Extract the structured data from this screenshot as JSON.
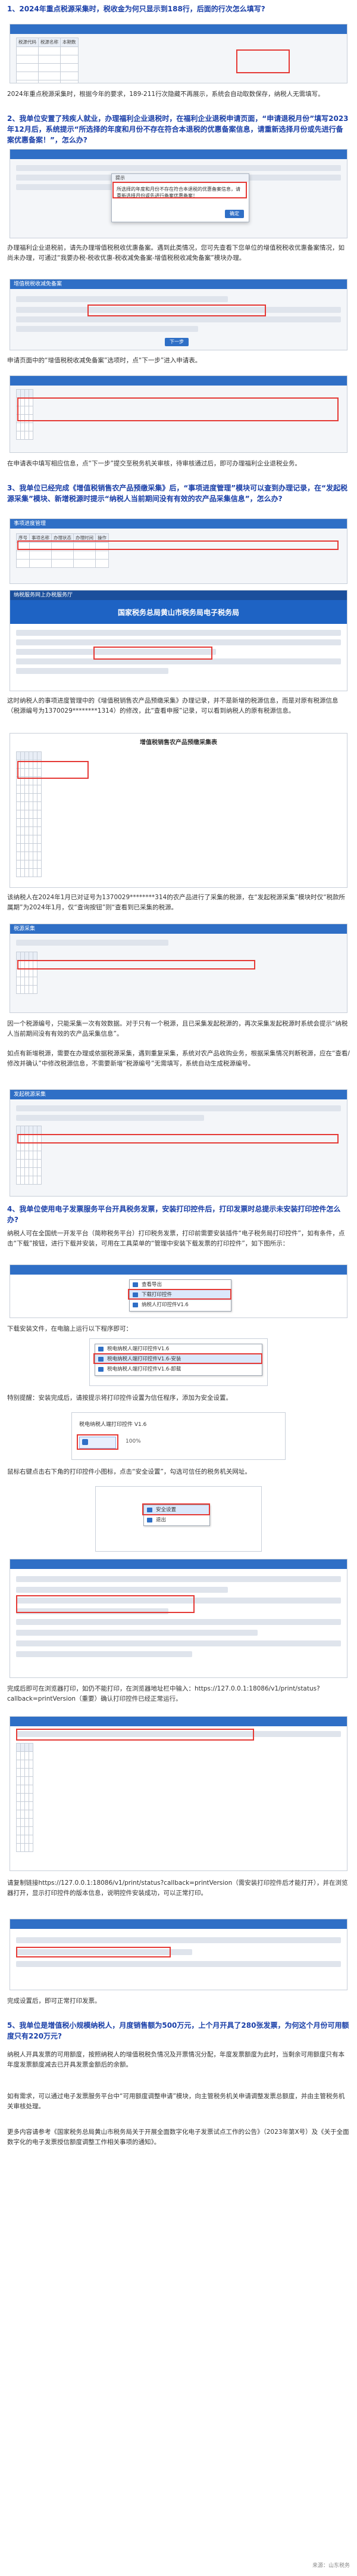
{
  "q1": {
    "title": "1、2024年重点税源采集时，税收金为何只显示到188行，后面的行次怎么填写?",
    "answer": "2024年重点税源采集时，根据今年的要求，189-211行次隐藏不再展示，系统会自动取数保存，纳税人无需填写。",
    "shot_items": [
      "税源代码",
      "税源名称",
      "本期数"
    ]
  },
  "q2": {
    "title": "2、我单位安置了残疾人就业，办理福利企业退税时，在福利企业退税申请页面，“申请退税月份”填写2023年12月后，系统提示“所选择的年度和月份不存在符合本退税的优惠备案信息，请重新选择月份或先进行备案优惠备案！”，怎么办?",
    "shot_popup_title": "提示",
    "shot_popup_text": "所选择的年度和月份不存在符合本退税的优惠备案信息，请重新选择月份或先进行备案优惠备案！",
    "shot_popup_btn": "确定",
    "answer": "办理福利企业退税前，请先办理增值税税收优惠备案。遇到此类情况，您可先查看下您单位的增值税税收优惠备案情况，如尚未办理，可通过“我要办税-税收优惠-税收减免备案-增值税税收减免备案”模块办理。",
    "shot2_bar": "增值税税收减免备案",
    "shot2_btn": "下一步",
    "answer2": "申请页面中的“增值税税收减免备案”选项时，点“下一步”进入申请表。",
    "answer3": "在申请表中填写相应信息，点“下一步”提交至税务机关审核，待审核通过后，即可办理福利企业退税业务。"
  },
  "q3": {
    "title": "3、我单位已经完成《增值税销售农产品预缴采集》后，“事项进度管理”模块可以查到办理记录，在“发起税源采集”模块、新增税源时提示“纳税人当前期间没有有效的农产品采集信息”，怎么办?",
    "shot_bar": "事项进度管理",
    "shot_cols": [
      "序号",
      "事项名称",
      "办理状态",
      "办理时间",
      "操作"
    ],
    "shot2_bar": "纳税服务网上办税服务厅",
    "shot2_subtitle": "国家税务总局黄山市税务局电子税务局",
    "answer": "这时纳税人的事项进度管理中的《增值税销售农产品预缴采集》办理记录，并不是新增的税源信息，而是对原有税源信息（税源编号为1370029********1314）的修改，此“查看申报”记录，可以看到纳税人的原有税源信息。",
    "shot3_title": "增值税销售农产品预缴采集表",
    "answer2": "该纳税人在2024年1月已对证号为1370029********314的农产品进行了采集的税源，在“发起税源采集”模块时仅“税款所属期”为2024年1月，仅“查询按钮”则“查看到已采集的税源。",
    "shot4_bar": "税源采集",
    "answer3": "因一个税源编号，只能采集一次有效数据。对于只有一个税源，且已采集发起税源的，再次采集发起税源时系统会提示“纳税人当前期间没有有效的农产品采集信息”。",
    "answer4": "如点有新增税源，需要在办理或依据税源采集，遇到重复采集，系统对农产品收购业务，根据采集情况判断税源，应在“查看/修改并确认”中修改税源信息，不需要新增“税源编号”无需填写，系统自动生成税源编号。",
    "shot5_bar": "发起税源采集"
  },
  "q4": {
    "title": "4、我单位使用电子发票服务平台开具税务发票，安装打印控件后，打印发票时总提示未安装打印控件怎么办?",
    "answer": "纳税人可在全国统一开发平台（简称税务平台）打印税务发票，打印前需要安装插件“电子税务局打印控件”，如有条件，点击“下载”按钮，进行下载并安装，可用在工具菜单的“管理中安装下载发票的打印控件”，如下图所示：",
    "menu_items": [
      "查看导出",
      "下载打印控件",
      "纳税人打印控件V1.6"
    ],
    "answer2": "下载安装文件，在电脑上运行以下程序即可：",
    "menu2_items": [
      "税电纳税人端打印控件V1.6",
      "税电纳税人端打印控件V1.6-安装",
      "税电纳税人端打印控件V1.6-卸载"
    ],
    "answer3": "特别提醒：安装完成后，请按提示将打印控件设置为信任程序，添加为安全设置。",
    "shot_control_label": "税电纳税人端打印控件 V1.6",
    "shot_zoom": "100%",
    "answer4": "鼠标右键点击右下角的打印控件小图标，点击“安全设置”，勾选可信任的税务机关网址。",
    "menu3_items": [
      "安全设置",
      "退出"
    ],
    "answer5": "完成后即可在浏览器打印，如仍不能打印，在浏览器地址栏中输入：https://127.0.0.1:18086/v1/print/status?callback=printVersion（重要）确认打印控件已经正常运行。",
    "answer6": "请复制链接https://127.0.0.1:18086/v1/print/status?callback=printVersion（需安装打印控件后才能打开），并在浏览器打开，显示打印控件的版本信息，说明控件安装成功，可以正常打印。",
    "answer7": "完成设置后，即可正常打印发票。"
  },
  "q5": {
    "title": "5、我单位是增值税小规模纳税人，月度销售额为500万元，上个月开具了280张发票，为何这个月份可用额度只有220万元?",
    "answer": "纳税人开具发票的可用额度，按照纳税人的增值税税负情况及开票情况分配，年度发票额度为此时，当剩余可用额度只有本年度发票额度减去已开具发票金额后的余额。",
    "answer2": "如有需求，可以通过电子发票服务平台中“可用额度调整申请”模块，向主管税务机关申请调整发票总额度，并由主管税务机关审核处理。",
    "answer3": "更多内容请参考《国家税务总局黄山市税务局关于开展全面数字化电子发票试点工作的公告》（2023年第X号）及《关于全面数字化的电子发票授信额度调整工作相关事项的通知》。",
    "source": "来源：山东税务"
  }
}
